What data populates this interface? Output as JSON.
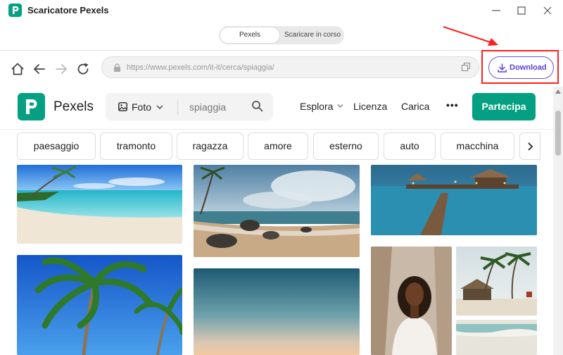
{
  "app": {
    "title": "Scaricatore Pexels",
    "logo_icon": "pexels-logo-icon"
  },
  "tabs": [
    {
      "label": "Pexels",
      "active": true
    },
    {
      "label": "Scaricare in corso",
      "active": false
    }
  ],
  "browser": {
    "url": "https://www.pexels.com/it-it/cerca/spiaggia/",
    "download_label": "Download",
    "accent_color": "#6d4fe6",
    "highlight_color": "#ff1f1f"
  },
  "site": {
    "brand": "Pexels",
    "brand_color": "#05a081",
    "search": {
      "type_label": "Foto",
      "value": "spiaggia"
    },
    "nav": {
      "explore": "Esplora",
      "license": "Licenza",
      "upload": "Carica",
      "more": "•••"
    },
    "join_label": "Partecipa"
  },
  "chips": [
    "paesaggio",
    "tramonto",
    "ragazza",
    "amore",
    "esterno",
    "auto",
    "macchina"
  ],
  "photos": [
    {
      "name": "photo-tropical-beach",
      "subject": "tropical-beach"
    },
    {
      "name": "photo-rocky-shore",
      "subject": "rocky-shore-clouds"
    },
    {
      "name": "photo-pier-dusk",
      "subject": "pier-dusk"
    },
    {
      "name": "photo-palm-trees",
      "subject": "palm-trees-sky"
    },
    {
      "name": "photo-gradient-sky",
      "subject": "gradient-sky"
    },
    {
      "name": "photo-woman-portrait",
      "subject": "woman-portrait"
    },
    {
      "name": "photo-palm-huts",
      "subject": "palm-huts"
    },
    {
      "name": "photo-waves",
      "subject": "waves"
    }
  ]
}
